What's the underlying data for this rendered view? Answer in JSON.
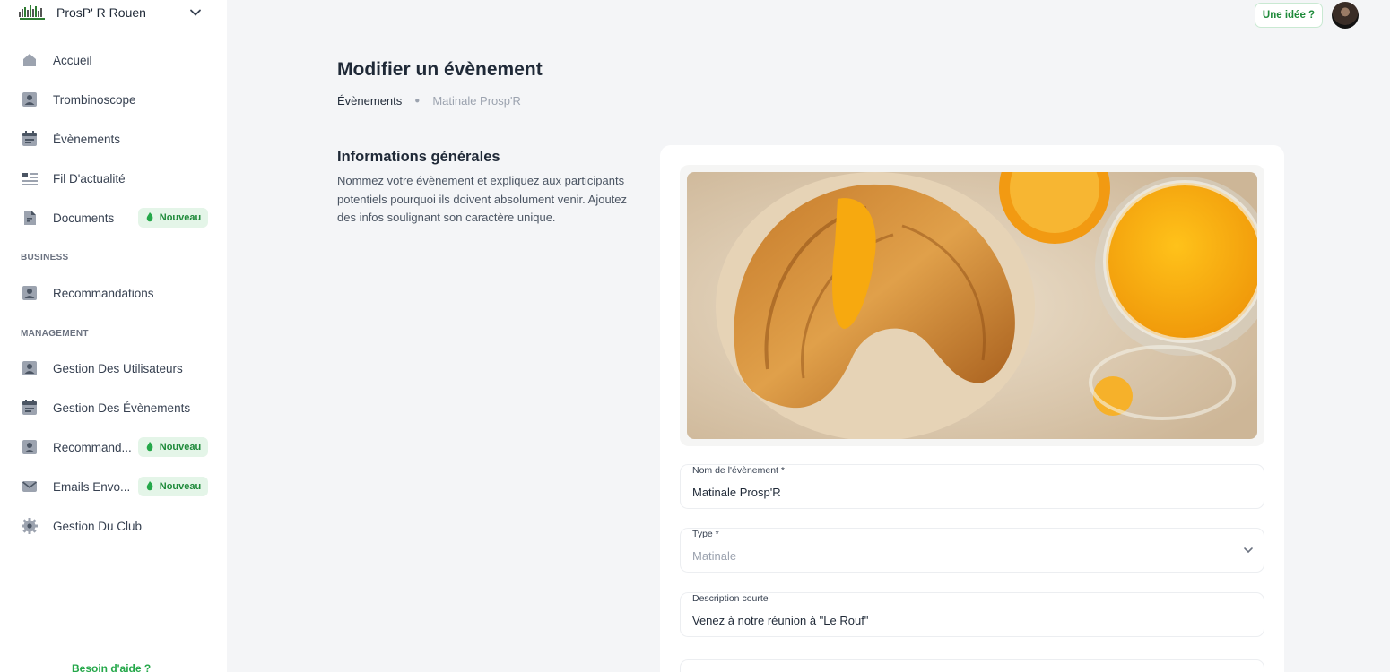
{
  "sidebar": {
    "brand_name": "ProsP' R Rouen",
    "items": [
      {
        "label": "Accueil",
        "icon": "home-icon"
      },
      {
        "label": "Trombinoscope",
        "icon": "person-icon"
      },
      {
        "label": "Évènements",
        "icon": "calendar-icon"
      },
      {
        "label": "Fil D'actualité",
        "icon": "news-icon"
      },
      {
        "label": "Documents",
        "icon": "document-icon",
        "badge": "Nouveau"
      }
    ],
    "business_title": "BUSINESS",
    "business_items": [
      {
        "label": "Recommandations",
        "icon": "person-icon"
      }
    ],
    "management_title": "MANAGEMENT",
    "management_items": [
      {
        "label": "Gestion Des Utilisateurs",
        "icon": "person-icon"
      },
      {
        "label": "Gestion Des Évènements",
        "icon": "calendar-icon"
      },
      {
        "label": "Recommand...",
        "icon": "person-icon",
        "badge": "Nouveau"
      },
      {
        "label": "Emails Envo...",
        "icon": "mail-icon",
        "badge": "Nouveau"
      },
      {
        "label": "Gestion Du Club",
        "icon": "gear-icon"
      }
    ],
    "help_link": "Besoin d'aide ?"
  },
  "topbar": {
    "idea_button": "Une idée ?"
  },
  "header": {
    "title": "Modifier un évènement",
    "breadcrumb": [
      "Évènements",
      "Matinale Prosp'R"
    ]
  },
  "general": {
    "title": "Informations générales",
    "description": "Nommez votre évènement et expliquez aux participants potentiels pourquoi ils doivent absolument venir. Ajoutez des infos soulignant son caractère unique."
  },
  "form": {
    "name_label": "Nom de l'évènement *",
    "name_value": "Matinale Prosp'R",
    "type_label": "Type *",
    "type_value": "Matinale",
    "short_desc_label": "Description courte",
    "short_desc_value": "Venez à notre réunion à \"Le Rouf\""
  },
  "colors": {
    "accent_green": "#25a84a",
    "badge_bg": "#e4f5e8",
    "page_bg": "#f4f5f7"
  }
}
